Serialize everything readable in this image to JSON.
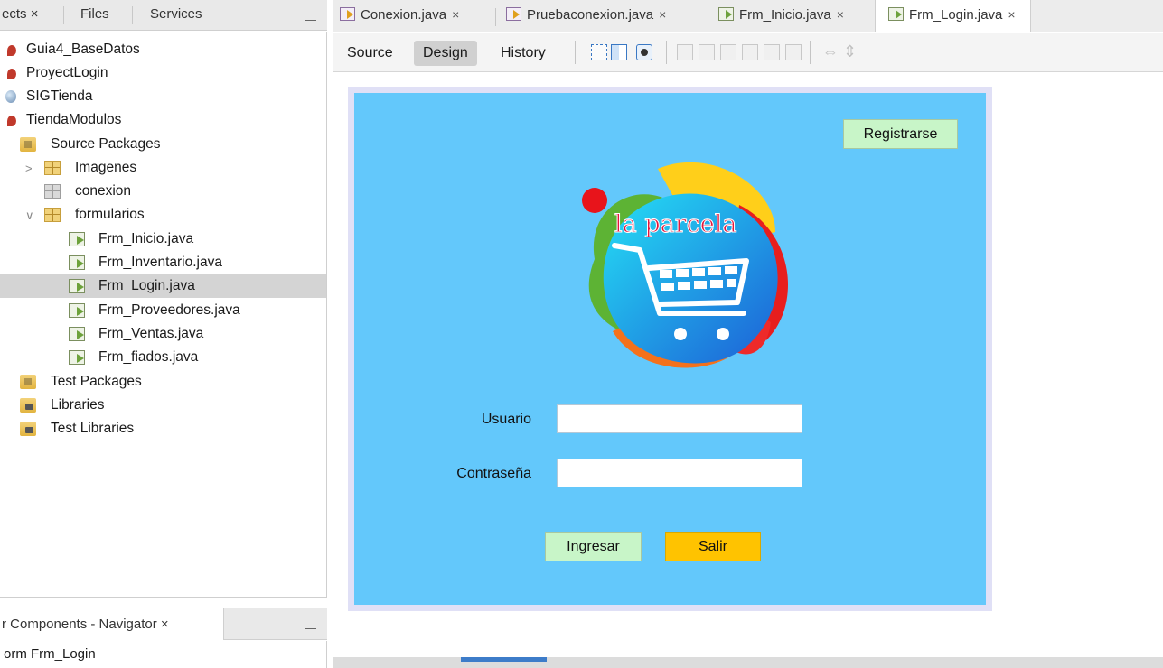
{
  "left_panel": {
    "tabs": [
      {
        "label": "ects",
        "close": "×"
      },
      {
        "label": "Files"
      },
      {
        "label": "Services"
      }
    ],
    "tree": [
      {
        "label": "Guia4_BaseDatos",
        "icon": "project-icon"
      },
      {
        "label": "ProyectLogin",
        "icon": "project-icon"
      },
      {
        "label": "SIGTienda",
        "icon": "globe-icon"
      },
      {
        "label": "TiendaModulos",
        "icon": "project-icon"
      },
      {
        "label": "Source Packages",
        "icon": "folder-icon"
      },
      {
        "label": "Imagenes",
        "icon": "package-icon",
        "chevron": ">"
      },
      {
        "label": "conexion",
        "icon": "package-icon"
      },
      {
        "label": "formularios",
        "icon": "package-icon",
        "chevron": "∨"
      },
      {
        "label": "Frm_Inicio.java",
        "icon": "form-icon"
      },
      {
        "label": "Frm_Inventario.java",
        "icon": "form-icon"
      },
      {
        "label": "Frm_Login.java",
        "icon": "form-icon",
        "selected": true
      },
      {
        "label": "Frm_Proveedores.java",
        "icon": "form-icon"
      },
      {
        "label": "Frm_Ventas.java",
        "icon": "form-icon"
      },
      {
        "label": "Frm_fiados.java",
        "icon": "form-icon"
      },
      {
        "label": "Test Packages",
        "icon": "folder-icon"
      },
      {
        "label": "Libraries",
        "icon": "library-icon"
      },
      {
        "label": "Test Libraries",
        "icon": "library-icon"
      }
    ],
    "navigator": {
      "tab_label": "r Components - Navigator",
      "close": "×",
      "content": "orm Frm_Login"
    }
  },
  "editor": {
    "tabs": [
      {
        "label": "Conexion.java",
        "close": "×"
      },
      {
        "label": "Pruebaconexion.java",
        "close": "×"
      },
      {
        "label": "Frm_Inicio.java",
        "close": "×"
      },
      {
        "label": "Frm_Login.java",
        "close": "×",
        "active": true
      }
    ],
    "toolbar": {
      "source": "Source",
      "design": "Design",
      "history": "History",
      "active": "Design",
      "arrows": "⇔ ⇕"
    },
    "form": {
      "background": "#63c8fb",
      "register_button": "Registrarse",
      "logo_text": "la parcela",
      "user_label": "Usuario",
      "password_label": "Contraseña",
      "user_value": "",
      "password_value": "",
      "login_button": "Ingresar",
      "exit_button": "Salir"
    }
  }
}
